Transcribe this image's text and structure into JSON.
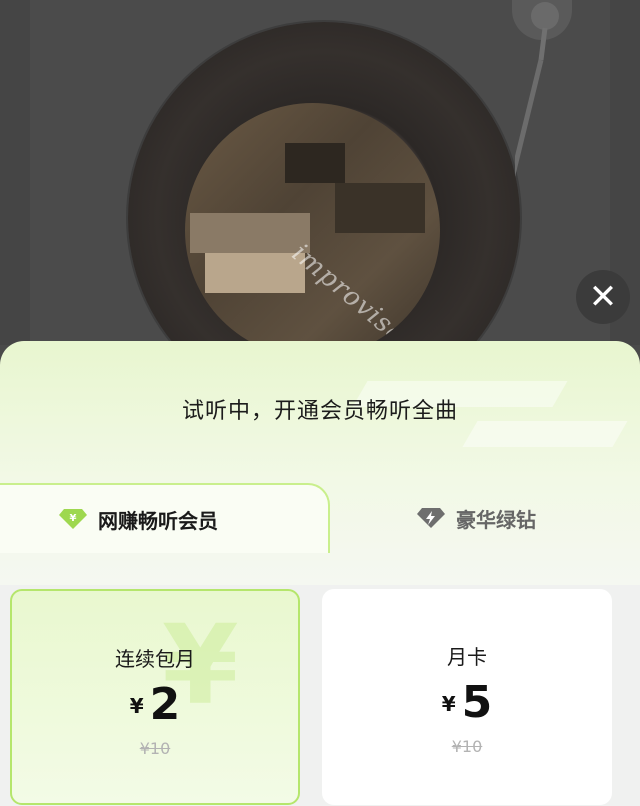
{
  "player": {
    "album_watermark": "improvisation"
  },
  "close_label": "✕",
  "sheet": {
    "title": "试听中，开通会员畅听全曲",
    "tabs": [
      {
        "label": "网赚畅听会员",
        "icon": "diamond-yen-icon",
        "active": true
      },
      {
        "label": "豪华绿钻",
        "icon": "diamond-bolt-icon",
        "active": false
      }
    ],
    "plans": [
      {
        "name": "连续包月",
        "currency": "¥",
        "price": "2",
        "original": "¥10",
        "selected": true
      },
      {
        "name": "月卡",
        "currency": "¥",
        "price": "5",
        "original": "¥10",
        "selected": false
      }
    ]
  },
  "colors": {
    "accent_green": "#b5e66c",
    "sheet_top": "#e8f6cf",
    "overlay": "#454545"
  }
}
